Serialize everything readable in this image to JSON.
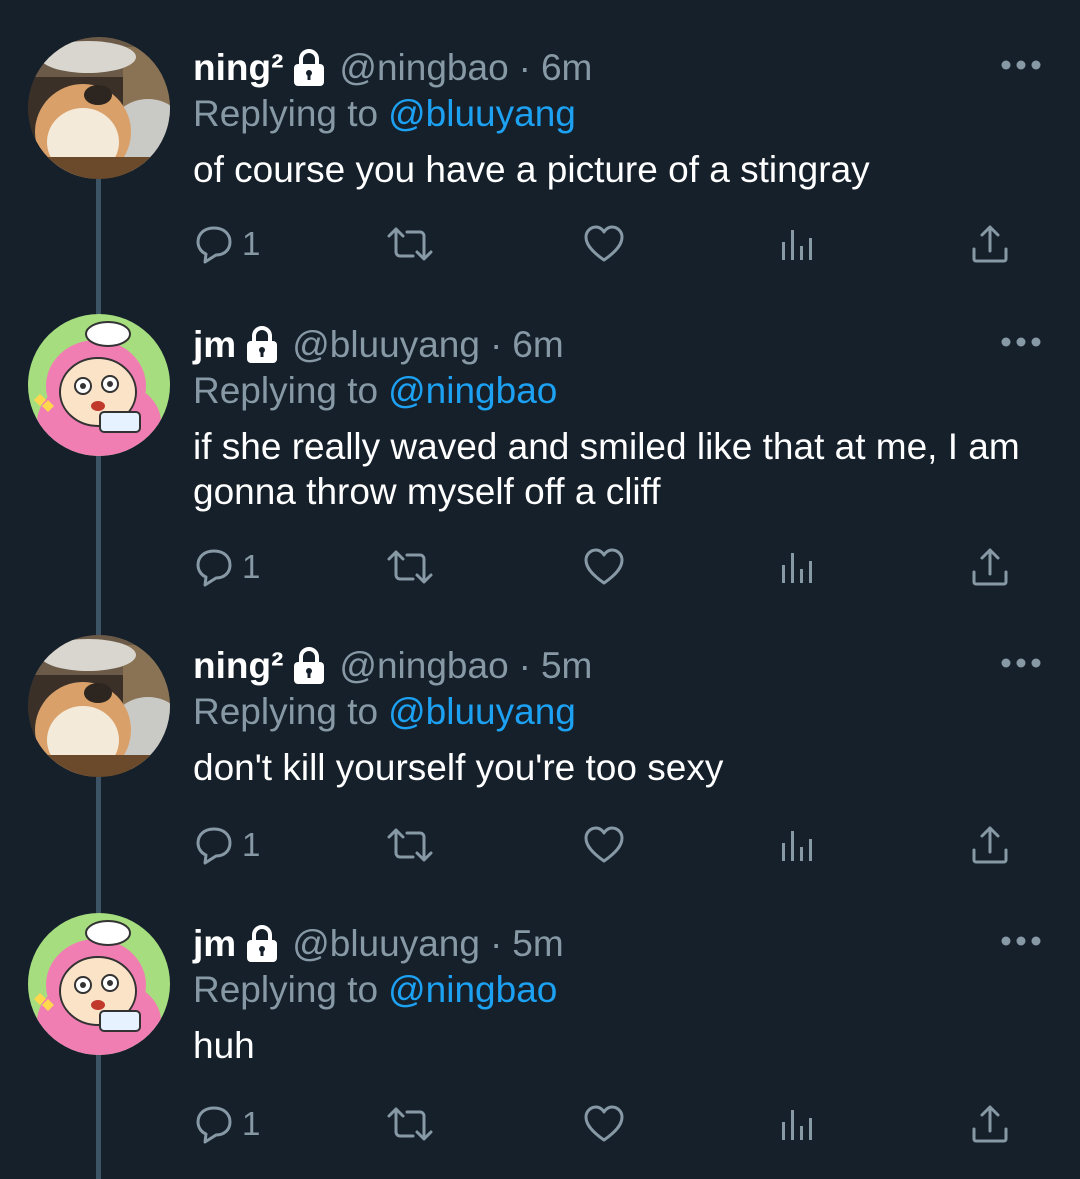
{
  "tweets": [
    {
      "name": "ning²",
      "handle": "@ningbao",
      "sep": "·",
      "time": "6m",
      "replying_label": "Replying to",
      "replying_to": "@bluuyang",
      "text": "of course you have a picture of a stingray",
      "reply_count": "1",
      "avatar": "dog"
    },
    {
      "name": "jm",
      "handle": "@bluuyang",
      "sep": "·",
      "time": "6m",
      "replying_label": "Replying to",
      "replying_to": "@ningbao",
      "text": "if she really waved and smiled like that at me, I am gonna throw myself off a cliff",
      "reply_count": "1",
      "avatar": "cartoon"
    },
    {
      "name": "ning²",
      "handle": "@ningbao",
      "sep": "·",
      "time": "5m",
      "replying_label": "Replying to",
      "replying_to": "@bluuyang",
      "text": "don't kill yourself you're too sexy",
      "reply_count": "1",
      "avatar": "dog"
    },
    {
      "name": "jm",
      "handle": "@bluuyang",
      "sep": "·",
      "time": "5m",
      "replying_label": "Replying to",
      "replying_to": "@ningbao",
      "text": "huh",
      "reply_count": "1",
      "avatar": "cartoon"
    }
  ],
  "icons": {
    "lock": "lock-icon",
    "more": "more-options-icon",
    "reply": "reply-icon",
    "retweet": "retweet-icon",
    "like": "like-icon",
    "analytics": "analytics-icon",
    "share": "share-icon"
  },
  "colors": {
    "background": "#15202b",
    "secondary_text": "#8899a6",
    "mention": "#1da1f2",
    "thread_line": "#3d5466"
  }
}
